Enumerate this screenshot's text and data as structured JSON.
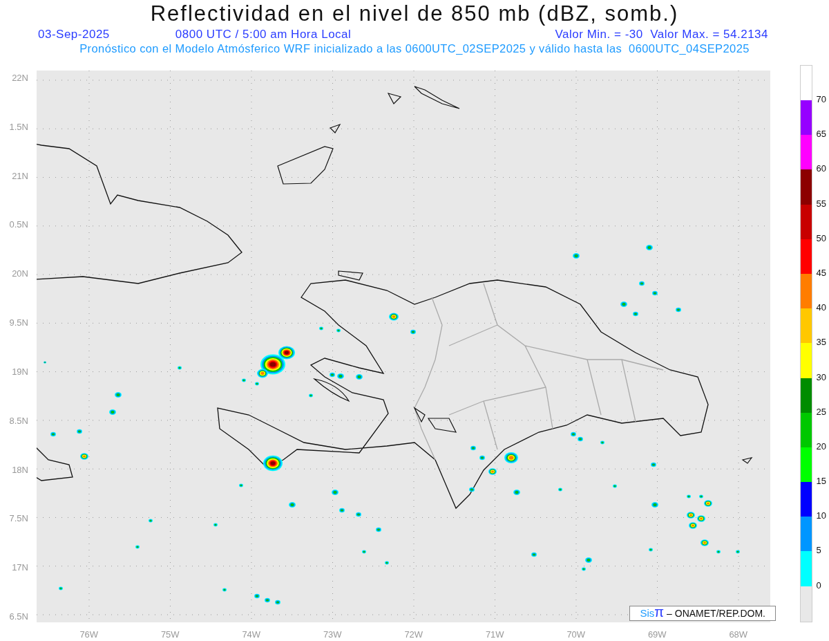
{
  "title": "Reflectividad en el nivel de 850 mb (dBZ, somb.)",
  "subtitle": {
    "date": "03-Sep-2025",
    "time": "0800 UTC / 5:00 am Hora Local",
    "range": "Valor Min. = -30  Valor Max. = 54.2134"
  },
  "description": "Pronóstico con el Modelo Atmósferico WRF inicializado a las 0600UTC_02SEP2025 y válido hasta las  0600UTC_04SEP2025",
  "y_axis": {
    "ticks": [
      "22N",
      "1.5N",
      "21N",
      "0.5N",
      "20N",
      "9.5N",
      "19N",
      "8.5N",
      "18N",
      "7.5N",
      "17N",
      "6.5N"
    ]
  },
  "x_axis": {
    "ticks": [
      "76W",
      "75W",
      "74W",
      "73W",
      "72W",
      "71W",
      "70W",
      "69W",
      "68W"
    ]
  },
  "credit": {
    "logo_prefix": "Sis",
    "logo_symbol": "π",
    "text": "– ONAMET/REP.DOM."
  },
  "colorbar": {
    "bottom_label": "0",
    "segments": [
      {
        "color": "#9600ff",
        "label": "70"
      },
      {
        "color": "#ff00ff",
        "label": "65"
      },
      {
        "color": "#8c0000",
        "label": "60"
      },
      {
        "color": "#c80000",
        "label": "55"
      },
      {
        "color": "#ff0000",
        "label": "50"
      },
      {
        "color": "#ff7d00",
        "label": "45"
      },
      {
        "color": "#ffc800",
        "label": "40"
      },
      {
        "color": "#ffff00",
        "label": "35"
      },
      {
        "color": "#008c00",
        "label": "30"
      },
      {
        "color": "#00c800",
        "label": "25"
      },
      {
        "color": "#00ff00",
        "label": "20"
      },
      {
        "color": "#0000ff",
        "label": "15"
      },
      {
        "color": "#0096ff",
        "label": "10"
      },
      {
        "color": "#00ffff",
        "label": "5"
      }
    ]
  }
}
